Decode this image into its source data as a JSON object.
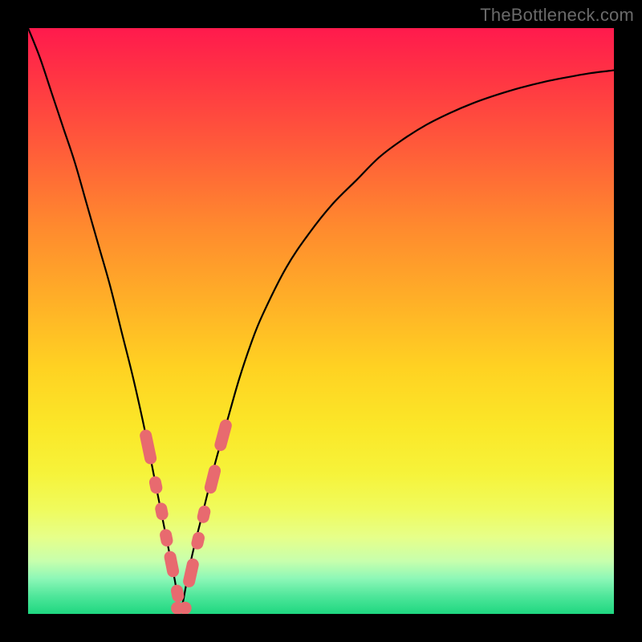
{
  "watermark": "TheBottleneck.com",
  "colors": {
    "frame": "#000000",
    "curve": "#000000",
    "bead": "#e86a6f",
    "gradient": [
      "#ff1a4d",
      "#ff3344",
      "#ff5a3a",
      "#ff8a2e",
      "#ffb127",
      "#ffd222",
      "#fbe728",
      "#f6f33a",
      "#f0fb5c",
      "#e6ff8a",
      "#c7ffad",
      "#8cf7b7",
      "#4ee69a",
      "#1fd780"
    ]
  },
  "chart_data": {
    "type": "line",
    "title": "",
    "xlabel": "",
    "ylabel": "",
    "xlim": [
      0,
      100
    ],
    "ylim": [
      0,
      100
    ],
    "note": "Magnitude-style V curve; no tick labels visible. x is horizontal position (0=left,100=right), y is curve height (0=bottom,100=top).",
    "minimum_x": 26,
    "series": [
      {
        "name": "curve",
        "x": [
          0,
          2,
          4,
          6,
          8,
          10,
          12,
          14,
          16,
          18,
          20,
          22,
          24,
          25,
          26,
          27,
          28,
          30,
          32,
          34,
          36,
          38,
          40,
          44,
          48,
          52,
          56,
          60,
          64,
          68,
          72,
          76,
          80,
          84,
          88,
          92,
          96,
          100
        ],
        "values": [
          100,
          95,
          89,
          83,
          77,
          70,
          63,
          56,
          48,
          40,
          31,
          21,
          11,
          6,
          1,
          5,
          10,
          18,
          26,
          33,
          40,
          46,
          51,
          59,
          65,
          70,
          74,
          78,
          81,
          83.5,
          85.5,
          87.2,
          88.6,
          89.8,
          90.8,
          91.6,
          92.3,
          92.8
        ]
      }
    ],
    "markers": [
      {
        "name": "left-bead-cluster",
        "shape": "rounded-rect",
        "points": [
          {
            "x": 20.5,
            "y": 28.5,
            "len": 6
          },
          {
            "x": 21.8,
            "y": 22,
            "len": 3
          },
          {
            "x": 22.8,
            "y": 17.5,
            "len": 3
          },
          {
            "x": 23.6,
            "y": 13,
            "len": 3
          },
          {
            "x": 24.5,
            "y": 8.5,
            "len": 4.5
          },
          {
            "x": 25.5,
            "y": 3.5,
            "len": 3
          }
        ]
      },
      {
        "name": "valley-beads",
        "shape": "circle",
        "points": [
          {
            "x": 25.5,
            "y": 1.0
          },
          {
            "x": 26.8,
            "y": 1.0
          }
        ]
      },
      {
        "name": "right-bead-cluster",
        "shape": "rounded-rect",
        "points": [
          {
            "x": 27.8,
            "y": 7,
            "len": 5
          },
          {
            "x": 29.0,
            "y": 12.5,
            "len": 3
          },
          {
            "x": 30.0,
            "y": 17,
            "len": 3
          },
          {
            "x": 31.5,
            "y": 23,
            "len": 5
          },
          {
            "x": 33.3,
            "y": 30.5,
            "len": 5.5
          }
        ]
      }
    ]
  }
}
